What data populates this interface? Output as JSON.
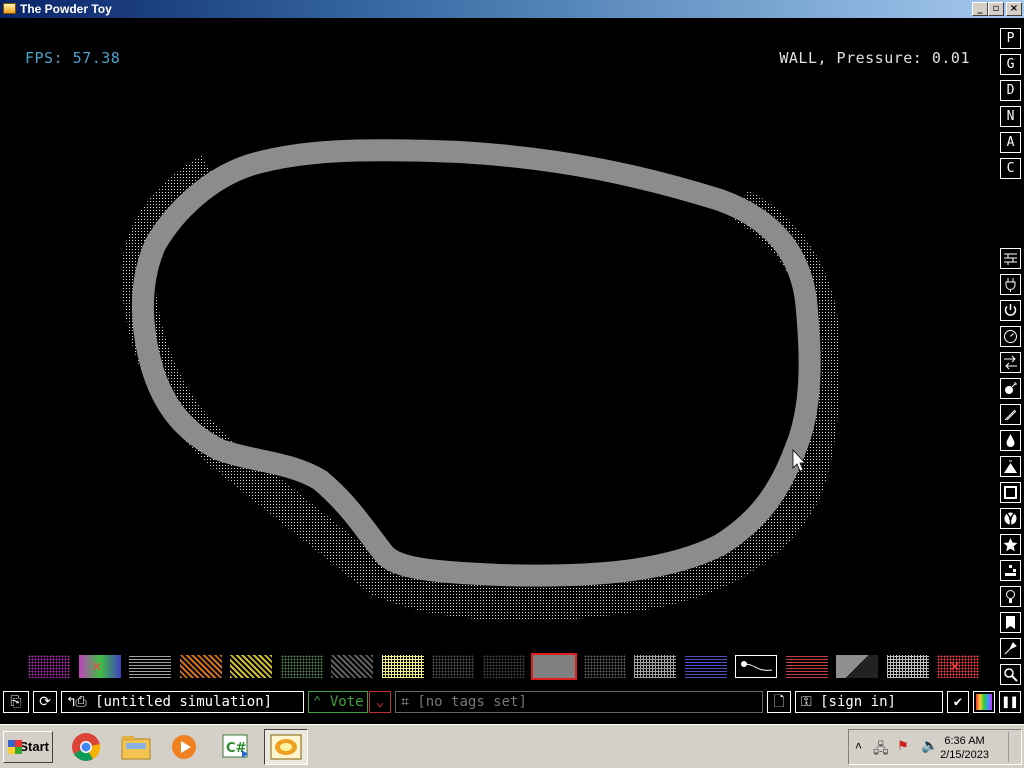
{
  "window": {
    "title": "The Powder Toy",
    "buttons": [
      "_",
      "▫",
      "×"
    ]
  },
  "hud": {
    "fps": "FPS: 57.38",
    "info": "WALL, Pressure: 0.01"
  },
  "sidebar": {
    "letter_buttons": [
      "P",
      "G",
      "D",
      "N",
      "A",
      "C"
    ],
    "menu_icons": [
      "walls-icon",
      "electronics-icon",
      "powered-icon",
      "sensors-icon",
      "force-icon",
      "explosives-icon",
      "gases-icon",
      "liquids-icon",
      "powders-icon",
      "solids-icon",
      "radioactive-icon",
      "special-icon",
      "life-icon",
      "tools-icon",
      "favorites-icon",
      "decoration-icon",
      "search-icon"
    ]
  },
  "palette": {
    "items": [
      {
        "name": "palette-item-1",
        "pattern": "dots",
        "color": "#b02ab0"
      },
      {
        "name": "palette-item-erase",
        "pattern": "cross",
        "color": "#ff4040"
      },
      {
        "name": "palette-item-3",
        "pattern": "hlines",
        "color": "#a0a0a0"
      },
      {
        "name": "palette-item-4",
        "pattern": "diag",
        "color": "#d07020"
      },
      {
        "name": "palette-item-5",
        "pattern": "diag",
        "color": "#d0c030"
      },
      {
        "name": "palette-item-6",
        "pattern": "dots",
        "color": "#508050"
      },
      {
        "name": "palette-item-7",
        "pattern": "diag",
        "color": "#606060"
      },
      {
        "name": "palette-item-8",
        "pattern": "grid",
        "color": "#f0f080"
      },
      {
        "name": "palette-item-9",
        "pattern": "dots",
        "color": "#505050"
      },
      {
        "name": "palette-item-10",
        "pattern": "dots",
        "color": "#404040"
      },
      {
        "name": "palette-item-wall-selected",
        "pattern": "solid",
        "color": "#808080"
      },
      {
        "name": "palette-item-12",
        "pattern": "dots",
        "color": "#606060"
      },
      {
        "name": "palette-item-13",
        "pattern": "grid",
        "color": "#a0a0a0"
      },
      {
        "name": "palette-item-14",
        "pattern": "hlines",
        "color": "#5050c0"
      },
      {
        "name": "palette-item-stream",
        "pattern": "stream",
        "color": "#ffffff"
      },
      {
        "name": "palette-item-16",
        "pattern": "hlines",
        "color": "#c04040"
      },
      {
        "name": "palette-item-17",
        "pattern": "wedge",
        "color": "#909090"
      },
      {
        "name": "palette-item-18",
        "pattern": "grid",
        "color": "#c0c0c0"
      },
      {
        "name": "palette-item-erase-wall",
        "pattern": "cross-dots",
        "color": "#ff4040"
      }
    ],
    "selected_color": "#e02020"
  },
  "bottom_bar": {
    "simulation_title": "[untitled simulation]",
    "vote_label": "Vote",
    "tags_label": "[no tags set]",
    "sign_in_label": "[sign in]"
  },
  "taskbar": {
    "start_label": "Start",
    "apps": [
      "chrome-icon",
      "file-explorer-icon",
      "media-player-icon",
      "csharp-icon",
      "powder-toy-icon"
    ],
    "clock_time": "6:36 AM",
    "clock_date": "2/15/2023"
  },
  "colors": {
    "wall": "#8c8c8c",
    "fps": "#4fa0c8",
    "vote": "#3fa03f"
  }
}
